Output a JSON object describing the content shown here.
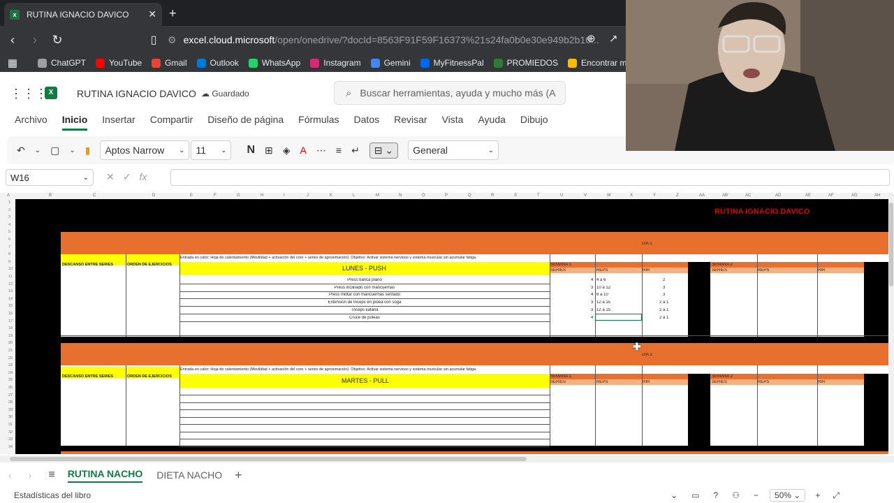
{
  "browser": {
    "tab_title": "RUTINA IGNACIO DAVICO",
    "tab_close": "✕",
    "new_tab": "+",
    "url_domain": "excel.cloud.microsoft",
    "url_path": "/open/onedrive/?docId=8563F91F59F16373%21s24fa0b0e30e949b2b16...",
    "bookmarks": [
      {
        "label": "ChatGPT",
        "color": "#9e9e9e"
      },
      {
        "label": "YouTube",
        "color": "#ff0000"
      },
      {
        "label": "Gmail",
        "color": "#ea4335"
      },
      {
        "label": "Outlook",
        "color": "#0078d4"
      },
      {
        "label": "WhatsApp",
        "color": "#25d366"
      },
      {
        "label": "Instagram",
        "color": "#d62976"
      },
      {
        "label": "Gemini",
        "color": "#4285f4"
      },
      {
        "label": "MyFitnessPal",
        "color": "#0066ee"
      },
      {
        "label": "PROMIEDOS",
        "color": "#2e7d32"
      },
      {
        "label": "Encontrar mi dis",
        "color": "#fbbc05"
      }
    ]
  },
  "excel": {
    "doc_name": "RUTINA IGNACIO DAVICO",
    "saved_status": "Guardado",
    "search_placeholder": "Buscar herramientas, ayuda y mucho más (A",
    "menu": [
      "Archivo",
      "Inicio",
      "Insertar",
      "Compartir",
      "Diseño de página",
      "Fórmulas",
      "Datos",
      "Revisar",
      "Vista",
      "Ayuda",
      "Dibujo"
    ],
    "font_name": "Aptos Narrow",
    "font_size": "11",
    "bold_label": "N",
    "number_format": "General",
    "name_box": "W16",
    "fx_label": "fx"
  },
  "sheet": {
    "title": "RUTINA IGNACIO DAVICO",
    "columns": [
      "A",
      "B",
      "C",
      "D",
      "E",
      "F",
      "G",
      "H",
      "I",
      "J",
      "K",
      "L",
      "M",
      "N",
      "O",
      "P",
      "Q",
      "R",
      "S",
      "T",
      "U",
      "V",
      "W",
      "X",
      "Y",
      "Z",
      "AA",
      "AB",
      "AC",
      "AD",
      "AE",
      "AF",
      "AG",
      "AH"
    ],
    "rows": [
      "1",
      "2",
      "3",
      "4",
      "5",
      "6",
      "7",
      "8",
      "9",
      "10",
      "11",
      "12",
      "13",
      "14",
      "15",
      "16",
      "17",
      "18",
      "19",
      "20",
      "21",
      "22",
      "23",
      "24",
      "25",
      "26",
      "27",
      "28",
      "29",
      "30",
      "31",
      "32",
      "33",
      "34"
    ],
    "day1": {
      "label": "DIA 1",
      "descanso": "DESCANSO ENTRE SERIES",
      "orden": "ORDEN DE EJERCICIOS",
      "warmup": "Entrada en calor: Hoja de calentamiento (Movilidad + activación del core + series de aproximación). Objetivo: Activar sistema nervioso y sistema muscular sin acumular fatiga.",
      "day_title": "LUNES - PUSH",
      "week1": "SEMANA 1",
      "week2": "SEMANA 2",
      "h_series": "SERIES",
      "h_reps": "REPS",
      "h_rir": "RIR",
      "exercises": [
        {
          "name": "Press banca plano",
          "series": "4",
          "reps": "4 a 6",
          "rir": "2"
        },
        {
          "name": "Press inclinado con mancuernas",
          "series": "3",
          "reps": "10 a 12",
          "rir": "3"
        },
        {
          "name": "Press militar con mancuernas sentado",
          "series": "4",
          "reps": "8 a 10",
          "rir": "3"
        },
        {
          "name": "Extension de triceps en polea con soga",
          "series": "3",
          "reps": "12 a 15",
          "rir": "2 a 1"
        },
        {
          "name": "Triceps katana",
          "series": "3",
          "reps": "12 a 15",
          "rir": "2 a 1"
        },
        {
          "name": "Cruce de poleas",
          "series": "4",
          "reps": "",
          "rir": "2 a 1"
        }
      ]
    },
    "day2": {
      "label": "DIA 2",
      "descanso": "DESCANSO ENTRE SERIES",
      "orden": "ORDEN DE EJERCICIOS",
      "warmup": "Entrada en calor: Hoja de calentamiento (Movilidad + activación del core + series de aproximación). Objetivo: Activar sistema nervioso y sistema muscular sin acumular fatiga.",
      "day_title": "MARTES - PULL",
      "week1": "SEMANA 1",
      "week2": "SEMANA 2",
      "h_series": "SERIES",
      "h_reps": "REPS",
      "h_rir": "RIR"
    }
  },
  "sheet_tabs": [
    "RUTINA NACHO",
    "DIETA NACHO"
  ],
  "active_sheet": "RUTINA NACHO",
  "status": {
    "stats": "Estadísticas del libro",
    "zoom": "50%"
  }
}
